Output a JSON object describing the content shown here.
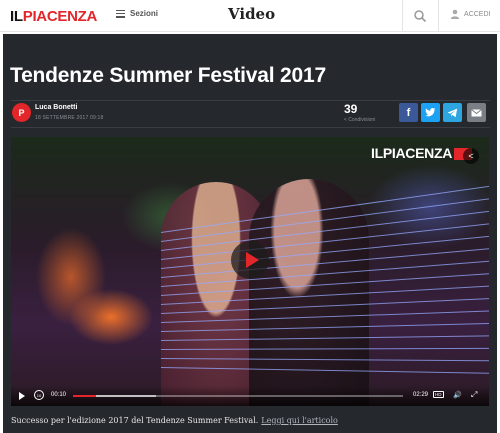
{
  "nav": {
    "logo_il": "IL",
    "logo_name": "PIACENZA",
    "sections_label": "Sezioni",
    "page_title": "Video",
    "login_label": "ACCEDI"
  },
  "article": {
    "title": "Tendenze Summer Festival 2017",
    "author": "Luca Bonetti",
    "date": "18 SETTEMBRE 2017 09:18",
    "avatar_text": "P",
    "share_count": "39",
    "share_label": "Condivisioni",
    "caption": "Successo per l'edizione 2017 del Tendenze Summer Festival.",
    "read_link": "Leggi qui l'articolo"
  },
  "share_buttons": [
    {
      "name": "facebook",
      "glyph": "f",
      "color": "#3b5998"
    },
    {
      "name": "twitter",
      "glyph": "t",
      "color": "#1da1f2"
    },
    {
      "name": "telegram",
      "glyph": "➤",
      "color": "#2ca5e0"
    },
    {
      "name": "email",
      "glyph": "✉",
      "color": "#7a7f86"
    }
  ],
  "video": {
    "watermark": "ILPIACENZA",
    "current_time": "00:10",
    "duration": "02:29",
    "hd_label": "HD",
    "progress": 0.07,
    "buffered": 0.25
  },
  "colors": {
    "brand_red": "#e2262a",
    "panel_bg": "#25282d"
  }
}
